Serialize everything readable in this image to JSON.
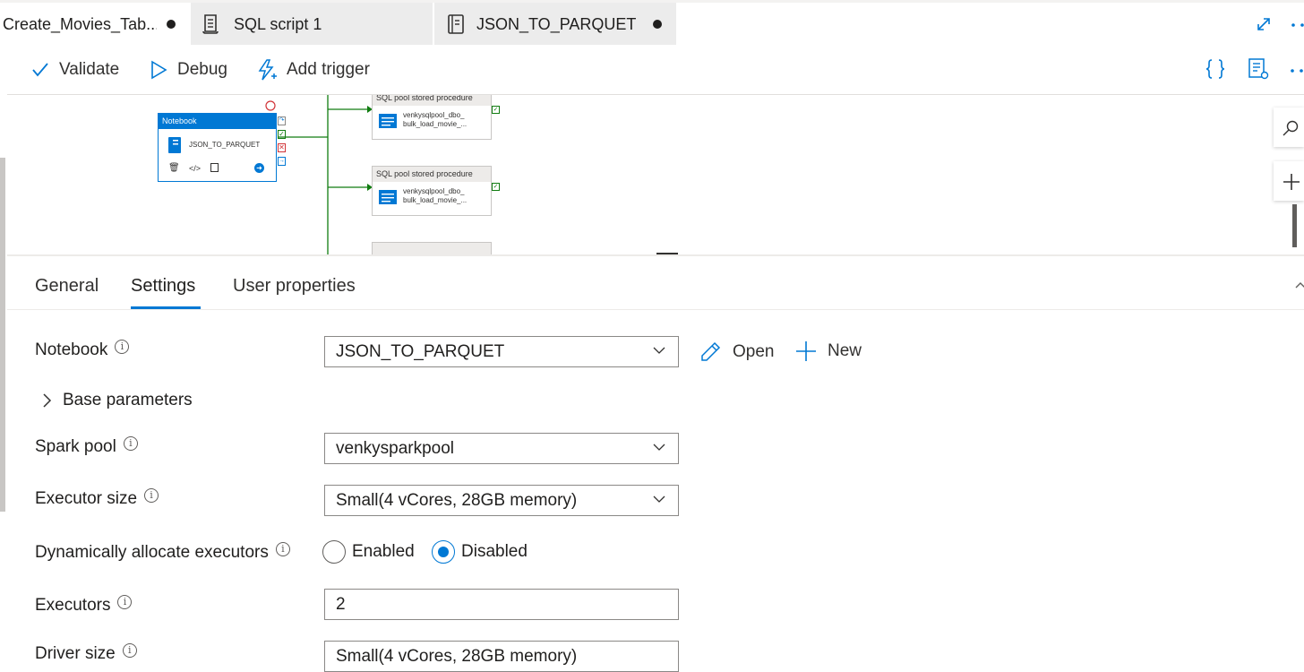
{
  "tabs": [
    {
      "label": "Create_Movies_Tab...",
      "dirty": true
    },
    {
      "label": "SQL script 1",
      "dirty": false
    },
    {
      "label": "JSON_TO_PARQUET",
      "dirty": true
    }
  ],
  "toolbar": {
    "validate": "Validate",
    "debug": "Debug",
    "add_trigger": "Add trigger"
  },
  "canvas": {
    "notebook_node": {
      "header": "Notebook",
      "name": "JSON_TO_PARQUET"
    },
    "sp_nodes": [
      {
        "header": "SQL pool stored procedure",
        "line1": "venkysqlpool_dbo_",
        "line2": "bulk_load_movie_..."
      },
      {
        "header": "SQL pool stored procedure",
        "line1": "venkysqlpool_dbo_",
        "line2": "bulk_load_movie_..."
      }
    ]
  },
  "panel": {
    "tabs": [
      "General",
      "Settings",
      "User properties"
    ],
    "active_tab": "Settings",
    "notebook_label": "Notebook",
    "notebook_value": "JSON_TO_PARQUET",
    "open_label": "Open",
    "new_label": "New",
    "base_parameters": "Base parameters",
    "spark_pool_label": "Spark pool",
    "spark_pool_value": "venkysparkpool",
    "executor_size_label": "Executor size",
    "executor_size_value": "Small(4 vCores, 28GB memory)",
    "dynamic_label": "Dynamically allocate executors",
    "enabled_label": "Enabled",
    "disabled_label": "Disabled",
    "dynamic_selected": "Disabled",
    "executors_label": "Executors",
    "executors_value": "2",
    "driver_size_label": "Driver size",
    "driver_size_value": "Small(4 vCores, 28GB memory)"
  },
  "colors": {
    "accent": "#0078d4",
    "success": "#107c10",
    "error": "#d13438"
  }
}
